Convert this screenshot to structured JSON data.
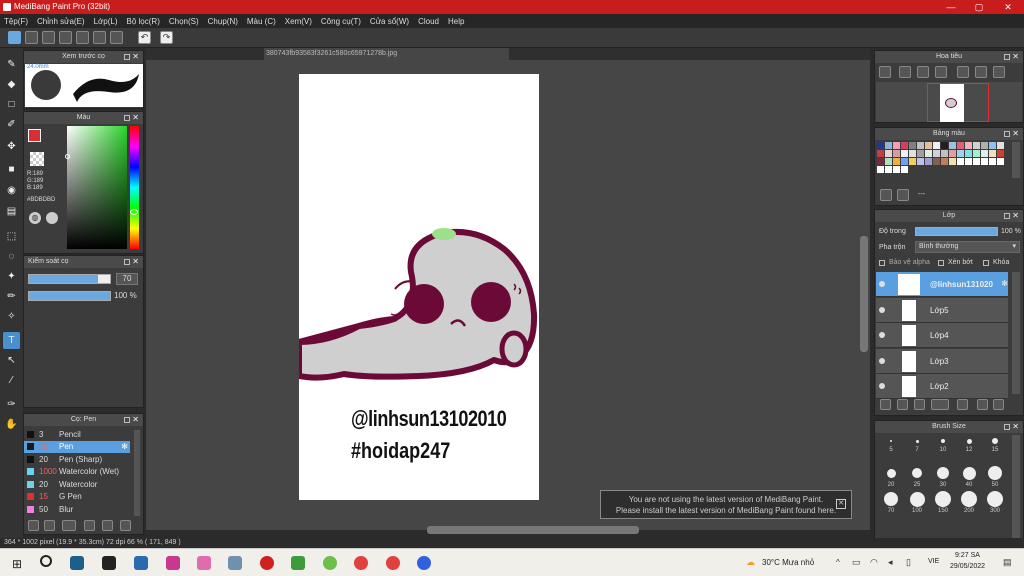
{
  "app": {
    "title": "MediBang Paint Pro (32bit)"
  },
  "menu": [
    "Tệp(F)",
    "Chỉnh sửa(E)",
    "Lớp(L)",
    "Bộ lọc(R)",
    "Chọn(S)",
    "Chụp(N)",
    "Màu (C)",
    "Xem(V)",
    "Công cụ(T)",
    "Cửa sổ(W)",
    "Cloud",
    "Help"
  ],
  "preview": {
    "title": "Xem trước cọ",
    "size": "24.0mm"
  },
  "color": {
    "title": "Màu",
    "r": "R:189",
    "g": "G:189",
    "b": "B:189",
    "hex": "#BDBDBD"
  },
  "brush_ctrl": {
    "title": "Kiểm soát cọ",
    "size": "70",
    "opacity": "100 %",
    "size_frac": 0.85,
    "opacity_frac": 1.0
  },
  "brush_list": {
    "title": "Cọ: Pen",
    "items": [
      {
        "n": "3",
        "name": "Pencil",
        "c": "#111111",
        "sel": false
      },
      {
        "n": "70",
        "name": "Pen",
        "c": "#1a1a1a",
        "sel": true
      },
      {
        "n": "20",
        "name": "Pen (Sharp)",
        "c": "#111111",
        "sel": false
      },
      {
        "n": "1000",
        "name": "Watercolor (Wet)",
        "c": "#6ad2f0",
        "sel": false
      },
      {
        "n": "20",
        "name": "Watercolor",
        "c": "#6ad2f0",
        "sel": false
      },
      {
        "n": "15",
        "name": "G Pen",
        "c": "#e03030",
        "sel": false
      },
      {
        "n": "50",
        "name": "Blur",
        "c": "#f080e0",
        "sel": false
      }
    ]
  },
  "canvas": {
    "tab": "380743fb93583f3261c580c65971278b.jpg",
    "text1": "@linhsun13102010",
    "text2": "#hoidap247"
  },
  "navigator": {
    "title": "Hoa tiêu"
  },
  "palette": {
    "title": "Bảng màu",
    "label": "---",
    "colors": [
      "#1e3a8a",
      "#8ab4d8",
      "#f0a0b0",
      "#d04060",
      "#808080",
      "#c0c0c0",
      "#e0c0a0",
      "#f0f0f0",
      "#202020",
      "#a0c0e0",
      "#e06070",
      "#f0b0c0",
      "#d0d0d0",
      "#b0b0b0",
      "#90c0f0",
      "#e0e0e0",
      "#c04040",
      "#f0d0d0",
      "#d0a0a0",
      "#f0f0f0",
      "#e0e0e0",
      "#a0a0a0",
      "#e0f0e0",
      "#d0d0e0",
      "#c0c0c0",
      "#e0a0a0",
      "#a0d0f0",
      "#80e0e0",
      "#a0f0d0",
      "#e0f0f0",
      "#f0e0c0",
      "#d04030",
      "#7a2a3a",
      "#b0e0c0",
      "#f0b040",
      "#70a0f0",
      "#f0d060",
      "#c0c0f0",
      "#a0a0d0",
      "#806050",
      "#c08060",
      "#f0e0b0",
      "#ffffff",
      "#ffffff",
      "#ffffff",
      "#ffffff",
      "#ffffff",
      "#ffffff",
      "#ffffff",
      "#ffffff",
      "#ffffff",
      "#ffffff"
    ]
  },
  "layer": {
    "title": "Lớp",
    "opacity_label": "Độ trong",
    "opacity": "100 %",
    "blend_label": "Pha trộn",
    "blend": "Bình thường",
    "protect_alpha": "Bảo vệ alpha",
    "clip": "Xén bớt",
    "lock": "Khóa",
    "items": [
      {
        "name": "@linhsun131020",
        "sel": true
      },
      {
        "name": "Lớp5",
        "sel": false
      },
      {
        "name": "Lớp4",
        "sel": false
      },
      {
        "name": "Lớp3",
        "sel": false
      },
      {
        "name": "Lớp2",
        "sel": false
      }
    ]
  },
  "brush_size": {
    "title": "Brush Size",
    "labels": [
      "5",
      "7",
      "10",
      "12",
      "15",
      "20",
      "25",
      "30",
      "40",
      "50",
      "70",
      "100",
      "150",
      "200",
      "300"
    ]
  },
  "notification": {
    "line1": "You are not using the latest version of MediBang Paint.",
    "line2": "Please install the latest version of MediBang Paint found here."
  },
  "status": {
    "text": "364 * 1002 pixel   (19.9 * 35.3cm)   72 dpi   66 %   ( 171, 849 )"
  },
  "taskbar": {
    "weather": "30°C  Mưa nhỏ",
    "lang": "VIE",
    "time": "9:27 SA",
    "date": "29/05/2022"
  }
}
